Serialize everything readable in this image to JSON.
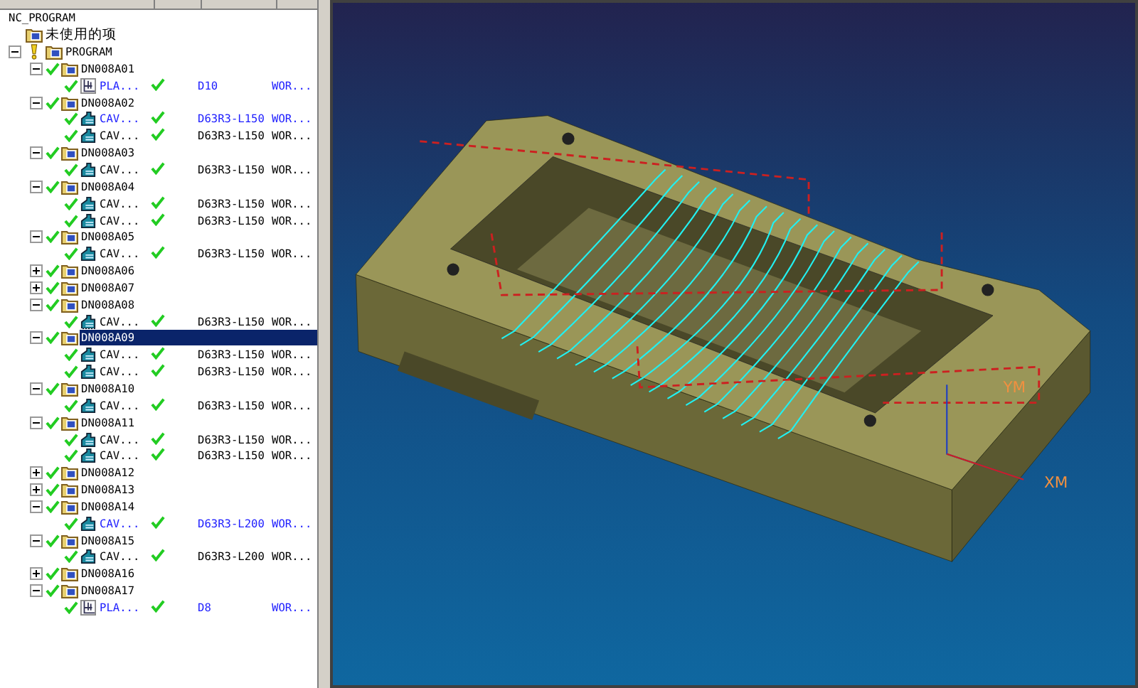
{
  "tree": {
    "root": "NC_PROGRAM",
    "unused": "未使用的项",
    "program": {
      "label": "PROGRAM",
      "expanded": true,
      "groups": [
        {
          "label": "DN008A01",
          "expanded": true,
          "checked": true,
          "selected": false,
          "ops": [
            {
              "kind": "planar",
              "name": "PLA...",
              "checked": true,
              "modified": true,
              "column_2_checked": true,
              "column_3": "D10",
              "column_4": "WOR..."
            }
          ]
        },
        {
          "label": "DN008A02",
          "expanded": true,
          "checked": true,
          "selected": false,
          "ops": [
            {
              "kind": "cavity",
              "name": "CAV...",
              "checked": true,
              "modified": true,
              "column_2_checked": true,
              "column_3": "D63R3-L150",
              "column_4": "WOR..."
            },
            {
              "kind": "cavity",
              "name": "CAV...",
              "checked": true,
              "modified": false,
              "column_2_checked": true,
              "column_3": "D63R3-L150",
              "column_4": "WOR..."
            }
          ]
        },
        {
          "label": "DN008A03",
          "expanded": true,
          "checked": true,
          "selected": false,
          "ops": [
            {
              "kind": "cavity",
              "name": "CAV...",
              "checked": true,
              "modified": false,
              "column_2_checked": true,
              "column_3": "D63R3-L150",
              "column_4": "WOR..."
            }
          ]
        },
        {
          "label": "DN008A04",
          "expanded": true,
          "checked": true,
          "selected": false,
          "ops": [
            {
              "kind": "cavity",
              "name": "CAV...",
              "checked": true,
              "modified": false,
              "column_2_checked": true,
              "column_3": "D63R3-L150",
              "column_4": "WOR..."
            },
            {
              "kind": "cavity",
              "name": "CAV...",
              "checked": true,
              "modified": false,
              "column_2_checked": true,
              "column_3": "D63R3-L150",
              "column_4": "WOR..."
            }
          ]
        },
        {
          "label": "DN008A05",
          "expanded": true,
          "checked": true,
          "selected": false,
          "ops": [
            {
              "kind": "cavity",
              "name": "CAV...",
              "checked": true,
              "modified": false,
              "column_2_checked": true,
              "column_3": "D63R3-L150",
              "column_4": "WOR..."
            }
          ]
        },
        {
          "label": "DN008A06",
          "expanded": false,
          "checked": true,
          "selected": false
        },
        {
          "label": "DN008A07",
          "expanded": false,
          "checked": true,
          "selected": false
        },
        {
          "label": "DN008A08",
          "expanded": true,
          "checked": true,
          "selected": false,
          "ops": [
            {
              "kind": "cavity",
              "name": "CAV...",
              "checked": true,
              "modified": false,
              "column_2_checked": true,
              "column_3": "D63R3-L150",
              "column_4": "WOR..."
            }
          ]
        },
        {
          "label": "DN008A09",
          "expanded": true,
          "checked": true,
          "selected": true,
          "ops": [
            {
              "kind": "cavity",
              "name": "CAV...",
              "checked": true,
              "modified": false,
              "column_2_checked": true,
              "column_3": "D63R3-L150",
              "column_4": "WOR..."
            },
            {
              "kind": "cavity",
              "name": "CAV...",
              "checked": true,
              "modified": false,
              "column_2_checked": true,
              "column_3": "D63R3-L150",
              "column_4": "WOR..."
            }
          ]
        },
        {
          "label": "DN008A10",
          "expanded": true,
          "checked": true,
          "selected": false,
          "ops": [
            {
              "kind": "cavity",
              "name": "CAV...",
              "checked": true,
              "modified": false,
              "column_2_checked": true,
              "column_3": "D63R3-L150",
              "column_4": "WOR..."
            }
          ]
        },
        {
          "label": "DN008A11",
          "expanded": true,
          "checked": true,
          "selected": false,
          "ops": [
            {
              "kind": "cavity",
              "name": "CAV...",
              "checked": true,
              "modified": false,
              "column_2_checked": true,
              "column_3": "D63R3-L150",
              "column_4": "WOR..."
            },
            {
              "kind": "cavity",
              "name": "CAV...",
              "checked": true,
              "modified": false,
              "column_2_checked": true,
              "column_3": "D63R3-L150",
              "column_4": "WOR..."
            }
          ]
        },
        {
          "label": "DN008A12",
          "expanded": false,
          "checked": true,
          "selected": false
        },
        {
          "label": "DN008A13",
          "expanded": false,
          "checked": true,
          "selected": false
        },
        {
          "label": "DN008A14",
          "expanded": true,
          "checked": true,
          "selected": false,
          "ops": [
            {
              "kind": "cavity",
              "name": "CAV...",
              "checked": true,
              "modified": true,
              "column_2_checked": true,
              "column_3": "D63R3-L200",
              "column_4": "WOR..."
            }
          ]
        },
        {
          "label": "DN008A15",
          "expanded": true,
          "checked": true,
          "selected": false,
          "ops": [
            {
              "kind": "cavity",
              "name": "CAV...",
              "checked": true,
              "modified": false,
              "column_2_checked": true,
              "column_3": "D63R3-L200",
              "column_4": "WOR..."
            }
          ]
        },
        {
          "label": "DN008A16",
          "expanded": false,
          "checked": true,
          "selected": false
        },
        {
          "label": "DN008A17",
          "expanded": true,
          "checked": true,
          "selected": false,
          "ops": [
            {
              "kind": "planar",
              "name": "PLA...",
              "checked": true,
              "modified": true,
              "column_2_checked": true,
              "column_3": "D8",
              "column_4": "WOR..."
            }
          ]
        }
      ]
    }
  },
  "viewport": {
    "axis_labels": [
      "YM",
      "XM"
    ]
  }
}
